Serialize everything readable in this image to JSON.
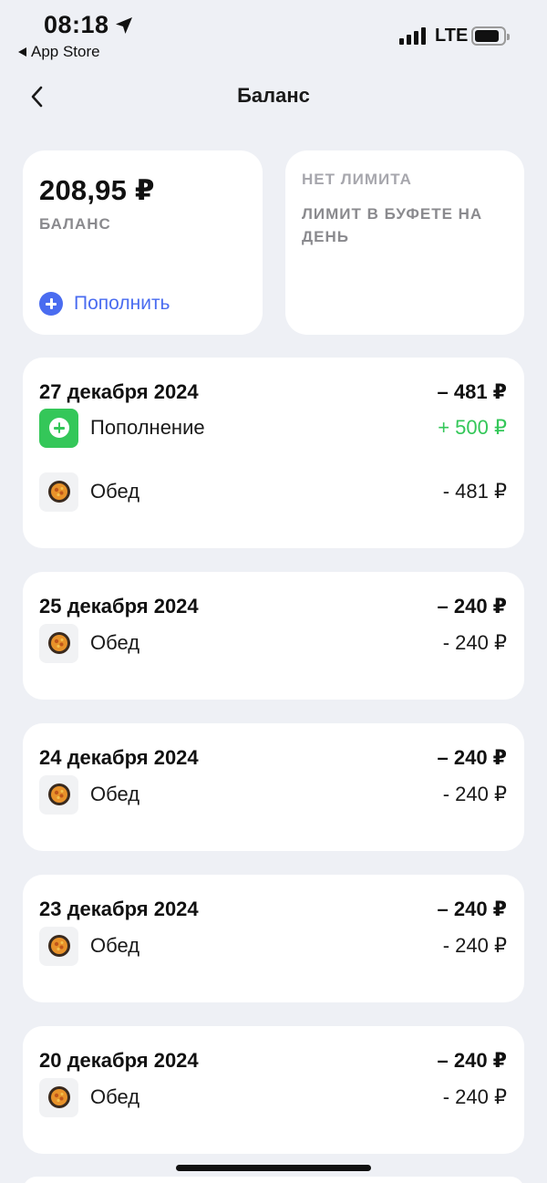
{
  "status_bar": {
    "time": "08:18",
    "back_app": "App Store",
    "network": "LTE",
    "icons": [
      "location-arrow-icon",
      "signal-icon",
      "battery-icon"
    ]
  },
  "nav": {
    "title": "Баланс",
    "back_icon": "chevron-left-icon"
  },
  "balance": {
    "amount": "208,95 ₽",
    "label": "БАЛАНС",
    "topup_label": "Пополнить",
    "accent": "#4A6CF0"
  },
  "limit": {
    "value": "НЕТ ЛИМИТА",
    "label": "ЛИМИТ В БУФЕТЕ НА ДЕНЬ"
  },
  "colors": {
    "background": "#EEF0F5",
    "positive": "#34C759",
    "accent": "#4A6CF0"
  },
  "history": [
    {
      "date": "27 декабря 2024",
      "total": "– 481 ₽",
      "items": [
        {
          "name": "Пополнение",
          "amount": "+ 500 ₽",
          "type": "topup",
          "icon": "plus-circle-icon"
        },
        {
          "name": "Обед",
          "amount": "- 481 ₽",
          "type": "meal",
          "icon": "meal-plate-icon"
        }
      ]
    },
    {
      "date": "25 декабря 2024",
      "total": "– 240 ₽",
      "items": [
        {
          "name": "Обед",
          "amount": "- 240 ₽",
          "type": "meal",
          "icon": "meal-plate-icon"
        }
      ]
    },
    {
      "date": "24 декабря 2024",
      "total": "– 240 ₽",
      "items": [
        {
          "name": "Обед",
          "amount": "- 240 ₽",
          "type": "meal",
          "icon": "meal-plate-icon"
        }
      ]
    },
    {
      "date": "23 декабря 2024",
      "total": "– 240 ₽",
      "items": [
        {
          "name": "Обед",
          "amount": "- 240 ₽",
          "type": "meal",
          "icon": "meal-plate-icon"
        }
      ]
    },
    {
      "date": "20 декабря 2024",
      "total": "– 240 ₽",
      "items": [
        {
          "name": "Обед",
          "amount": "- 240 ₽",
          "type": "meal",
          "icon": "meal-plate-icon"
        }
      ]
    }
  ]
}
